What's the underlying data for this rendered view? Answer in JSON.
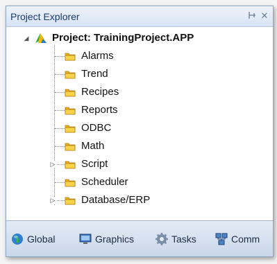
{
  "panel": {
    "title": "Project Explorer",
    "pin_glyph": "⊣",
    "close_glyph": "✕"
  },
  "tree": {
    "root_label": "Project: TrainingProject.APP",
    "items": [
      {
        "label": "Alarms",
        "expandable": false
      },
      {
        "label": "Trend",
        "expandable": false
      },
      {
        "label": "Recipes",
        "expandable": false
      },
      {
        "label": "Reports",
        "expandable": false
      },
      {
        "label": "ODBC",
        "expandable": false
      },
      {
        "label": "Math",
        "expandable": false
      },
      {
        "label": "Script",
        "expandable": true
      },
      {
        "label": "Scheduler",
        "expandable": false
      },
      {
        "label": "Database/ERP",
        "expandable": true
      }
    ]
  },
  "tabs": [
    {
      "label": "Global",
      "icon": "globe-icon"
    },
    {
      "label": "Graphics",
      "icon": "monitor-icon"
    },
    {
      "label": "Tasks",
      "icon": "gear-icon",
      "active": true
    },
    {
      "label": "Comm",
      "icon": "network-icon"
    }
  ],
  "colors": {
    "folder": "#e8b020",
    "accent": "#1b3a6b"
  }
}
